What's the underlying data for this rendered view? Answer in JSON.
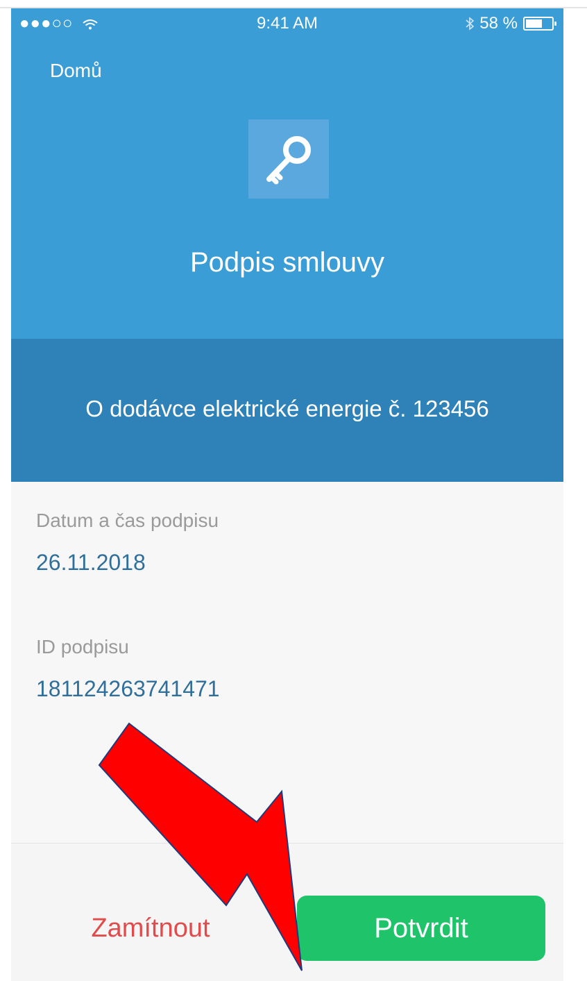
{
  "status_bar": {
    "left": "●●●○○",
    "time": "9:41 AM",
    "battery": "58 %",
    "battery_level": 0.58
  },
  "header": {
    "back_label": "Domů",
    "title": "Podpis smlouvy"
  },
  "band": {
    "text": "O dodávce elektrické energie č. 123456"
  },
  "details": {
    "date_label": "Datum a čas podpisu",
    "date_value": "26.11.2018",
    "id_label": "ID podpisu",
    "id_value": "181124263741471"
  },
  "actions": {
    "reject_label": "Zamítnout",
    "confirm_label": "Potvrdit"
  },
  "colors": {
    "header": "#3a9dd6",
    "band": "#2e82b7",
    "confirm": "#1fc46a",
    "reject": "#e04c4c",
    "annotation_arrow": "#ff0000"
  }
}
